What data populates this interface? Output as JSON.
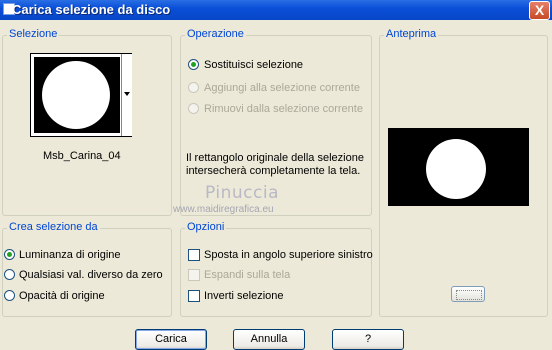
{
  "window": {
    "title": "Carica selezione da disco",
    "close_label": "X"
  },
  "selezione": {
    "legend": "Selezione",
    "selected_name": "Msb_Carina_04"
  },
  "operazione": {
    "legend": "Operazione",
    "options": [
      {
        "label": "Sostituisci selezione",
        "checked": true,
        "enabled": true
      },
      {
        "label": "Aggiungi alla selezione corrente",
        "checked": false,
        "enabled": false
      },
      {
        "label": "Rimuovi dalla selezione corrente",
        "checked": false,
        "enabled": false
      }
    ],
    "message_line1": "Il rettangolo originale della selezione",
    "message_line2": "intersecherà completamente la tela."
  },
  "anteprima": {
    "legend": "Anteprima"
  },
  "watermark": {
    "line1": "Pinuccia",
    "line2": "www.maidiregrafica.eu"
  },
  "crea": {
    "legend": "Crea selezione da",
    "options": [
      {
        "label": "Luminanza di origine",
        "checked": true
      },
      {
        "label": "Qualsiasi val. diverso da zero",
        "checked": false
      },
      {
        "label": "Opacità di origine",
        "checked": false
      }
    ]
  },
  "opzioni": {
    "legend": "Opzioni",
    "items": [
      {
        "label": "Sposta in angolo superiore sinistro",
        "checked": false,
        "enabled": true
      },
      {
        "label": "Espandi sulla tela",
        "checked": false,
        "enabled": false
      },
      {
        "label": "Inverti selezione",
        "checked": false,
        "enabled": true
      }
    ]
  },
  "buttons": {
    "ok": "Carica",
    "cancel": "Annulla",
    "help": "?"
  },
  "colors": {
    "titlebar": "#0a4fd8",
    "dialog_bg": "#ece9d8",
    "group_title": "#0046d5"
  }
}
